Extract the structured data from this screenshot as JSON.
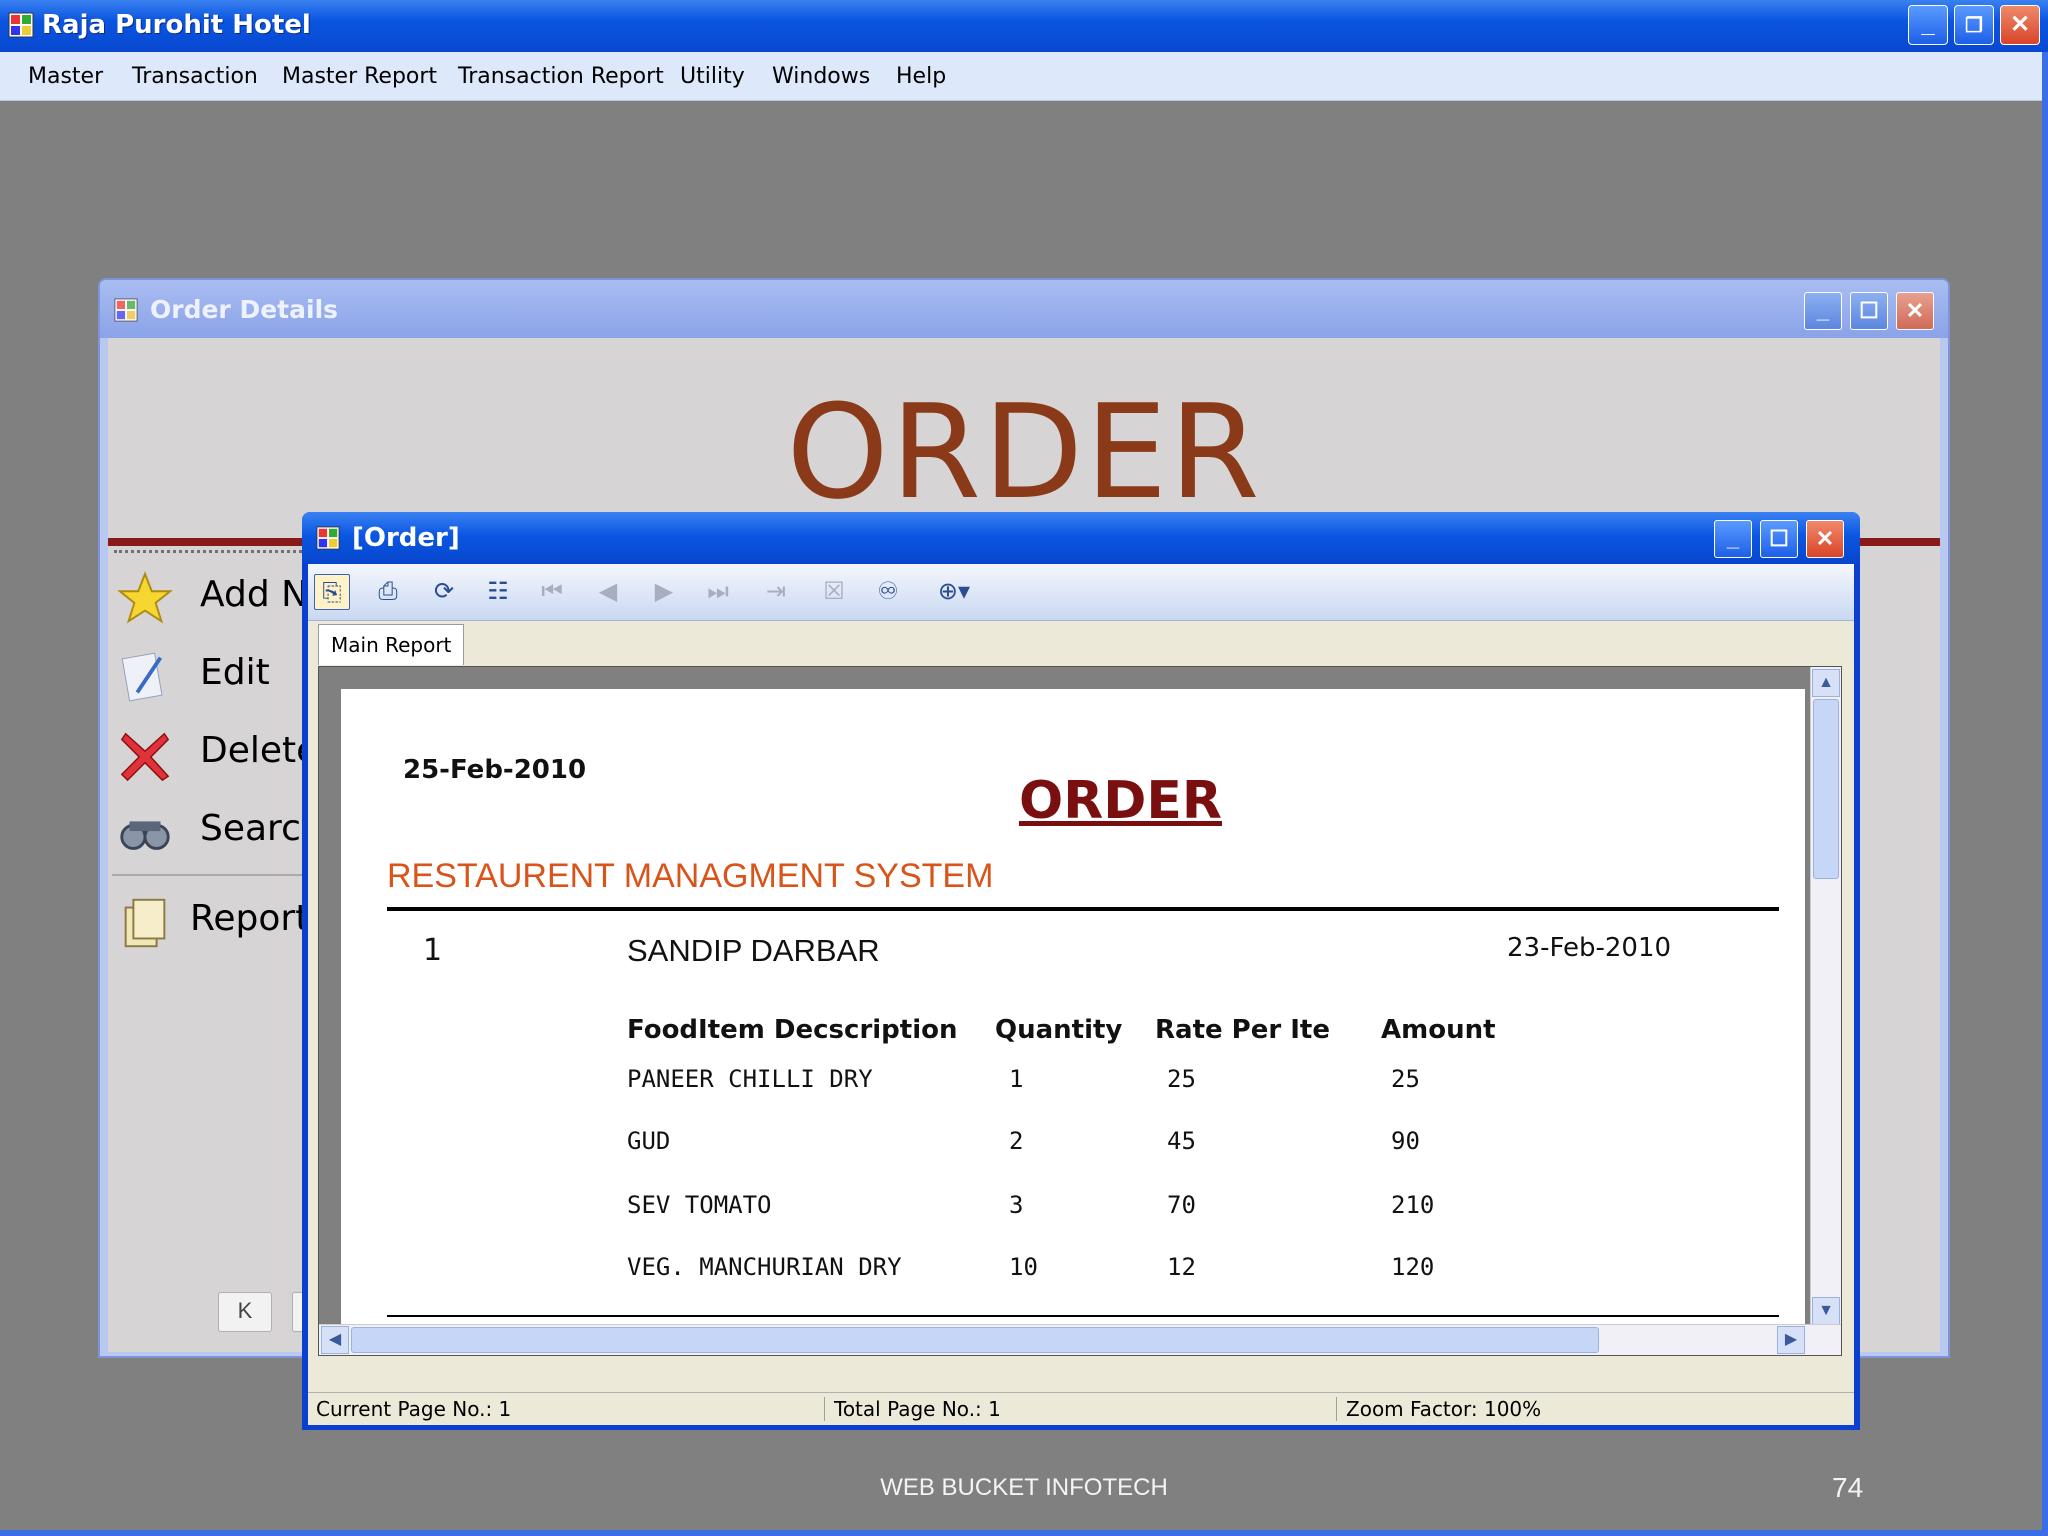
{
  "app": {
    "title": "Raja Purohit Hotel",
    "menu": [
      "Master",
      "Transaction",
      "Master Report",
      "Transaction Report",
      "Utility",
      "Windows",
      "Help"
    ]
  },
  "order_details": {
    "title": "Order Details",
    "heading": "ORDER",
    "side_items": [
      "Add N",
      "Edit",
      "Delete",
      "Search",
      "Report"
    ],
    "nav": [
      "K",
      "<",
      ">"
    ]
  },
  "report_viewer": {
    "title": "[Order]",
    "tab": "Main Report",
    "status": {
      "current_page": "Current Page No.: 1",
      "total_page": "Total Page No.: 1",
      "zoom": "Zoom Factor: 100%"
    }
  },
  "report": {
    "print_date": "25-Feb-2010",
    "title": "ORDER",
    "system_name": "RESTAURENT MANAGMENT SYSTEM",
    "order_no": "1",
    "customer": "SANDIP DARBAR",
    "order_date": "23-Feb-2010",
    "columns": [
      "FoodItem Decscription",
      "Quantity",
      "Rate Per Ite",
      "Amount"
    ],
    "rows": [
      [
        "PANEER CHILLI DRY",
        "1",
        "25",
        "25"
      ],
      [
        "GUD",
        "2",
        "45",
        "90"
      ],
      [
        "SEV TOMATO",
        "3",
        "70",
        "210"
      ],
      [
        "VEG. MANCHURIAN DRY",
        "10",
        "12",
        "120"
      ]
    ]
  },
  "footer": {
    "company": "WEB BUCKET INFOTECH",
    "slide_number": "74"
  },
  "colors": {
    "xp_blue": "#0a55e0",
    "order_heading": "#8a3a18",
    "report_title": "#7a0f0f",
    "system_name": "#d8541a"
  }
}
